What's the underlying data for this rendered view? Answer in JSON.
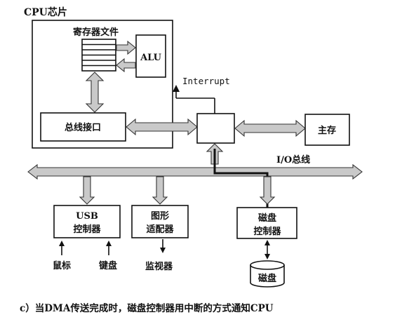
{
  "cpu_chip_label": "CPU芯片",
  "register_file_label": "寄存器文件",
  "alu_label": "ALU",
  "bus_interface_label": "总线接口",
  "interrupt_label": "Interrupt",
  "main_memory_label": "主存",
  "io_bus_label": "I/O总线",
  "usb_controller": {
    "line1": "USB",
    "line2": "控制器"
  },
  "graphics_adapter": {
    "line1": "图形",
    "line2": "适配器"
  },
  "disk_controller": {
    "line1": "磁盘",
    "line2": "控制器"
  },
  "mouse_label": "鼠标",
  "keyboard_label": "键盘",
  "monitor_label": "监视器",
  "disk_label": "磁盘",
  "caption": "c）当DMA传送完成时，磁盘控制器用中断的方式通知CPU"
}
